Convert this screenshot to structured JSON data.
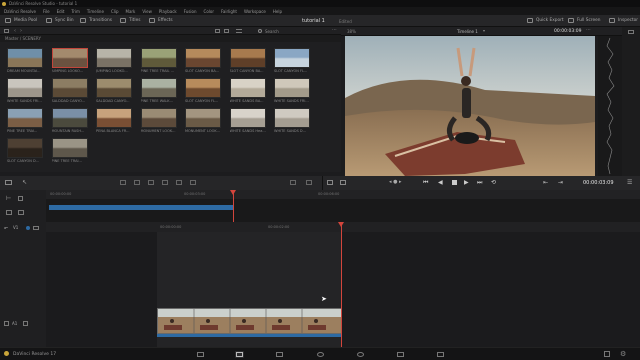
{
  "app": {
    "title": "DaVinci Resolve Studio - tutorial 1",
    "footer_name": "DaVinci Resolve 17"
  },
  "menu": [
    "DaVinci Resolve",
    "File",
    "Edit",
    "Trim",
    "Timeline",
    "Clip",
    "Mark",
    "View",
    "Playback",
    "Fusion",
    "Color",
    "Fairlight",
    "Workspace",
    "Help"
  ],
  "toolbar": {
    "media_pool": "Media Pool",
    "sync_bin": "Sync Bin",
    "transitions": "Transitions",
    "titles": "Titles",
    "effects": "Effects",
    "project_title": "tutorial 1",
    "project_status": "Edited",
    "quick_export": "Quick Export",
    "full_screen": "Full Screen",
    "inspector": "Inspector"
  },
  "media_pool": {
    "search_label": "Search",
    "breadcrumb": "Master / SCENERY",
    "clips": [
      {
        "label": "DREAM MOUNTAI...",
        "selected": false
      },
      {
        "label": "JUMPING LOOKO...",
        "selected": true
      },
      {
        "label": "JUMPING LOOKO...",
        "selected": false
      },
      {
        "label": "PINE TREE TRAIL ...",
        "selected": false
      },
      {
        "label": "SLOT CANYON BA...",
        "selected": false
      },
      {
        "label": "SLOT CANYON BA...",
        "selected": false
      },
      {
        "label": "SLOT CANYON FL...",
        "selected": false
      },
      {
        "label": "WHITE SANDS FRI...",
        "selected": false
      },
      {
        "label": "SALDDAD CANYO...",
        "selected": false
      },
      {
        "label": "SALDDAD CANYO...",
        "selected": false
      },
      {
        "label": "PINE TREE WALK...",
        "selected": false
      },
      {
        "label": "SLOT CANYON FL...",
        "selected": false
      },
      {
        "label": "WHITE SANDS BA...",
        "selected": false
      },
      {
        "label": "WHITE SANDS FRI...",
        "selected": false
      },
      {
        "label": "PINE TREE TRAI...",
        "selected": false
      },
      {
        "label": "MOUNTAIN RASH...",
        "selected": false
      },
      {
        "label": "PENA BLANCA FR...",
        "selected": false
      },
      {
        "label": "MONUMENT LOOK...",
        "selected": false
      },
      {
        "label": "MONUMENT LOOK...",
        "selected": false
      },
      {
        "label": "WHITE SANDS Hea...",
        "selected": false
      },
      {
        "label": "WHITE SANDS D...",
        "selected": false
      },
      {
        "label": "SLOT CANYON D...",
        "selected": false
      },
      {
        "label": "PINE TREE TRAI...",
        "selected": false
      }
    ]
  },
  "viewer": {
    "zoom": "38%",
    "source_tc": "00:00:03:09",
    "timeline_name": "Timeline 1",
    "timecode": "00:00:03:09"
  },
  "timeline": {
    "upper_ruler": [
      "00:00:00:00",
      "00:00:03:00",
      "00:00:06:00"
    ],
    "lower_ruler": [
      "00:00:00:00",
      "00:00:02:00"
    ],
    "track_v1": "V1",
    "track_a1": "A1"
  },
  "colors": {
    "accent_red": "#d2453c",
    "clip_blue": "#2d6aa3",
    "viewer_bg": "#111112"
  },
  "pages": [
    "media-icon",
    "cut-icon",
    "edit-icon",
    "fusion-icon",
    "color-icon",
    "fairlight-icon",
    "deliver-icon"
  ]
}
